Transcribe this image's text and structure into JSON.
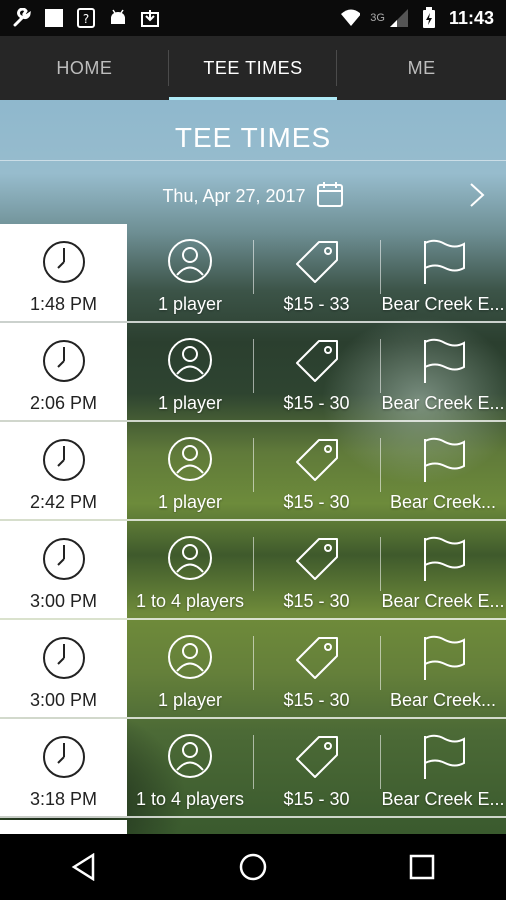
{
  "status_bar": {
    "time": "11:43",
    "network": "3G",
    "icons": [
      "wrench-icon",
      "blank-square-icon",
      "unknown-app-icon",
      "android-icon",
      "download-box-icon",
      "wifi-icon",
      "signal-icon",
      "battery-charging-icon"
    ]
  },
  "tabs": [
    {
      "label": "HOME",
      "active": false
    },
    {
      "label": "TEE TIMES",
      "active": true
    },
    {
      "label": "ME",
      "active": false
    }
  ],
  "header": {
    "title": "TEE TIMES",
    "date": "Thu, Apr 27, 2017",
    "accent": "#aee9f5"
  },
  "tee_times": [
    {
      "time": "1:48 PM",
      "players": "1 player",
      "price": "$15 - 33",
      "course": "Bear Creek E..."
    },
    {
      "time": "2:06 PM",
      "players": "1 player",
      "price": "$15 - 30",
      "course": "Bear Creek E..."
    },
    {
      "time": "2:42 PM",
      "players": "1 player",
      "price": "$15 - 30",
      "course": "Bear Creek..."
    },
    {
      "time": "3:00 PM",
      "players": "1 to 4 players",
      "price": "$15 - 30",
      "course": "Bear Creek E..."
    },
    {
      "time": "3:00 PM",
      "players": "1 player",
      "price": "$15 - 30",
      "course": "Bear Creek..."
    },
    {
      "time": "3:18 PM",
      "players": "1 to 4 players",
      "price": "$15 - 30",
      "course": "Bear Creek E..."
    }
  ],
  "navbar": [
    "back-icon",
    "home-circle-icon",
    "recents-square-icon"
  ]
}
